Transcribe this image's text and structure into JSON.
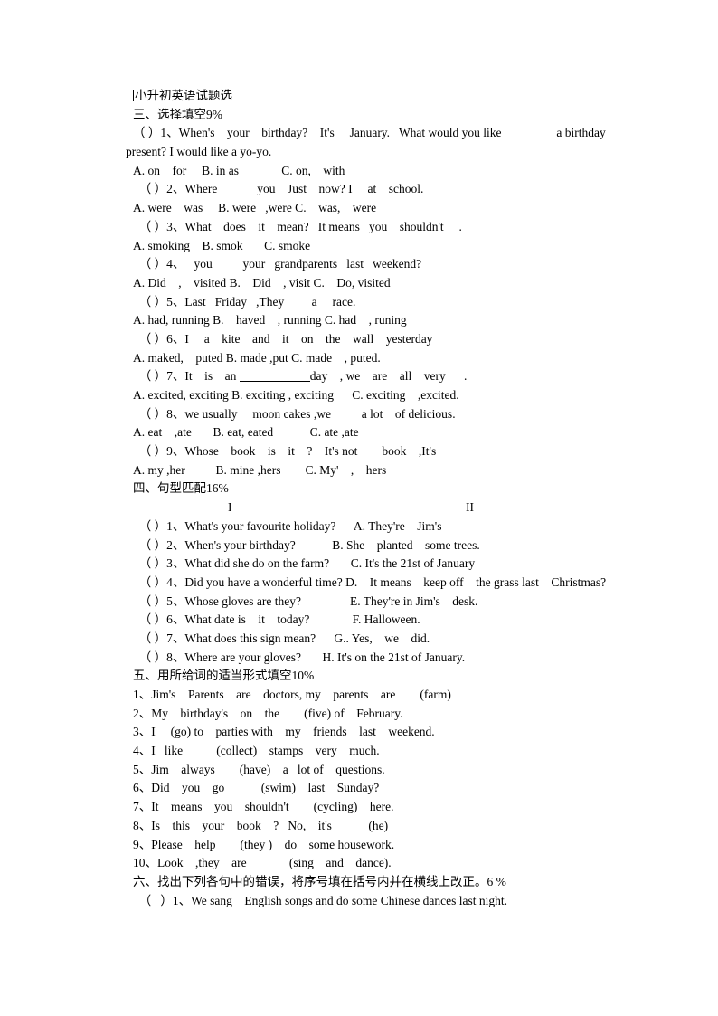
{
  "document": {
    "title": "小升初英语试题选"
  },
  "section3": {
    "heading": "三、选择填空",
    "points": "9%",
    "questions": [
      {
        "stem_a": "（ ）1、When's    your    birthday?    It's     January.   What would you like ",
        "stem_b": "    a birthday",
        "stem_cont": "present? I would like a yo-yo.",
        "options": "A. on    for     B. in as              C. on,    with"
      },
      {
        "stem": "  （ ）2、Where             you    Just    now? I     at    school.",
        "options": "A. were    was     B. were   ,were C.    was,    were"
      },
      {
        "stem": "  （ ）3、What    does    it    mean?   It means   you    shouldn't     .",
        "options": "A. smoking    B. smok       C. smoke"
      },
      {
        "stem": "  （ ）4、   you          your   grandparents   last   weekend?",
        "options": "A. Did    ,    visited B.    Did    , visit C.    Do, visited"
      },
      {
        "stem": "  （ ）5、Last   Friday   ,They         a     race.",
        "options": "A. had, running B.    haved    , running C. had    , runing"
      },
      {
        "stem": "  （ ）6、I     a    kite    and    it    on    the    wall    yesterday",
        "options": "A. maked,    puted B. made ,put C. made    , puted."
      },
      {
        "stem_a": "  （ ）7、It    is    an ",
        "stem_b": "day    , we    are    all    very      .",
        "options": "A. excited, exciting B. exciting , exciting      C. exciting    ,excited."
      },
      {
        "stem": "  （ ）8、we usually     moon cakes ,we          a lot    of delicious.",
        "options": "A. eat    ,ate       B. eat, eated            C. ate ,ate"
      },
      {
        "stem": "  （ ）9、Whose    book    is    it    ?    It's not        book    ,It's",
        "options": "A. my ,her          B. mine ,hers        C. My'    ,    hers"
      }
    ]
  },
  "section4": {
    "heading": "四、句型匹配",
    "points": "16%",
    "col1_label": "I",
    "col2_label": "II",
    "rows": [
      "  （ ）1、What's your favourite holiday?      A. They're    Jim's",
      "  （ ）2、When's your birthday?            B. She    planted    some trees.",
      "  （ ）3、What did she do on the farm?       C. It's the 21st of January",
      "  （ ）4、Did you have a wonderful time? D.    It means    keep off    the grass last    Christmas?",
      "  （ ）5、Whose gloves are they?                E. They're in Jim's    desk.",
      "  （ ）6、What date is    it    today?              F. Halloween.",
      "  （ ）7、What does this sign mean?      G.. Yes,    we    did.",
      "  （ ）8、Where are your gloves?       H. It's on the 21st of January."
    ]
  },
  "section5": {
    "heading": "五、用所给词的适当形式填空",
    "points": "10%",
    "items": [
      "1、Jim's    Parents    are    doctors, my    parents    are        (farm)",
      "2、My    birthday's    on    the        (five) of    February.",
      "3、I     (go) to    parties with    my    friends    last    weekend.",
      "4、I   like           (collect)    stamps    very    much.",
      "5、Jim    always        (have)    a   lot of    questions.",
      "6、Did    you    go            (swim)    last    Sunday?",
      "7、It    means    you    shouldn't        (cycling)    here.",
      "8、Is    this    your    book    ?   No,    it's            (he)",
      "9、Please    help        (they )    do    some housework.",
      "10、Look    ,they    are              (sing    and    dance)."
    ]
  },
  "section6": {
    "heading": "六、找出下列各句中的错误，将序号填在括号内并在横线上改正。",
    "points": "6 %",
    "items": [
      "  （   ）1、We sang    English songs and do some Chinese dances last night."
    ]
  }
}
